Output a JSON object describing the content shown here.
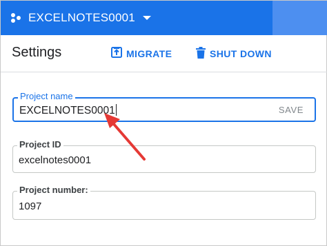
{
  "header": {
    "project_name": "EXCELNOTES0001",
    "icons": [
      "project-icon",
      "dropdown-arrow-icon"
    ]
  },
  "toolbar": {
    "title": "Settings",
    "migrate_label": "MIGRATE",
    "shutdown_label": "SHUT DOWN"
  },
  "fields": {
    "project_name": {
      "label": "Project name",
      "value": "EXCELNOTES0001",
      "action": "SAVE"
    },
    "project_id": {
      "label": "Project ID",
      "value": "excelnotes0001"
    },
    "project_number": {
      "label": "Project number:",
      "value": "1097"
    }
  },
  "colors": {
    "accent": "#1a73e8",
    "annotation_arrow": "#e53935"
  }
}
